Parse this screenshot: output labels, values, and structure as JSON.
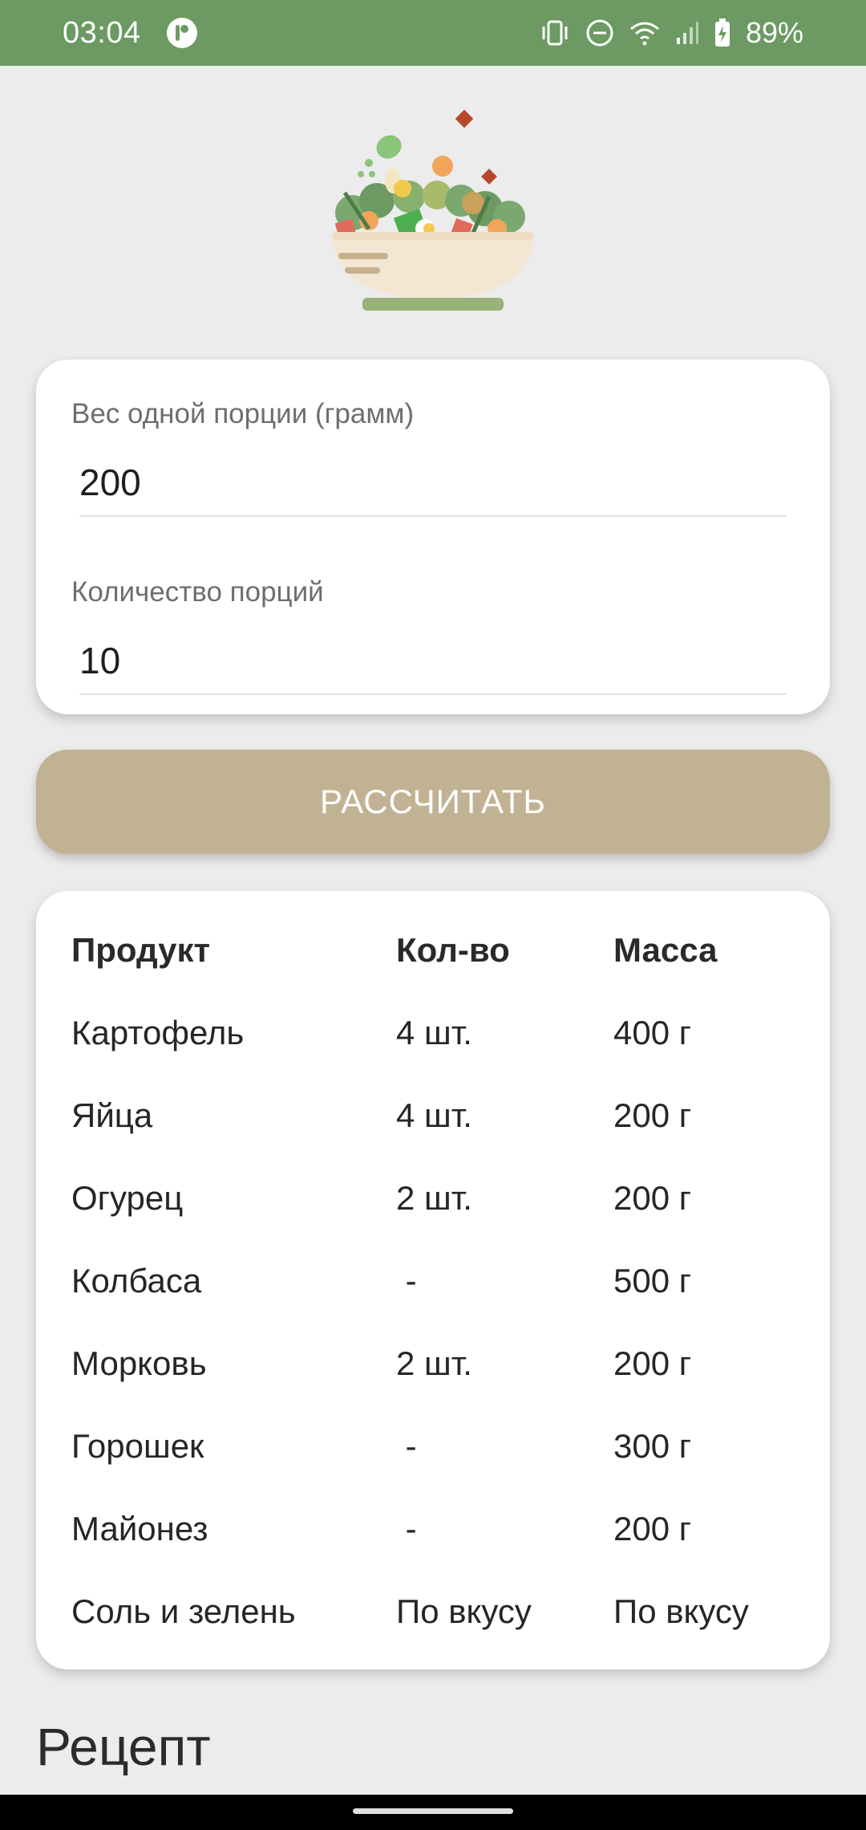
{
  "status_bar": {
    "time": "03:04",
    "battery": "89%",
    "icons": [
      "app-notification-icon",
      "vibrate-icon",
      "do-not-disturb-icon",
      "wifi-icon",
      "signal-icon",
      "battery-charging-icon"
    ]
  },
  "inputs": {
    "portion_weight_label": "Вес одной порции (грамм)",
    "portion_weight_value": "200",
    "portion_count_label": "Количество порций",
    "portion_count_value": "10"
  },
  "calc_button_label": "РАССЧИТАТЬ",
  "table": {
    "headers": [
      "Продукт",
      "Кол-во",
      "Масса"
    ],
    "rows": [
      [
        "Картофель",
        "4 шт.",
        "400 г"
      ],
      [
        "Яйца",
        "4 шт.",
        "200 г"
      ],
      [
        "Огурец",
        "2 шт.",
        "200 г"
      ],
      [
        "Колбаса",
        " -",
        "500 г"
      ],
      [
        "Морковь",
        "2 шт.",
        "200 г"
      ],
      [
        "Горошек",
        " -",
        "300 г"
      ],
      [
        "Майонез",
        " -",
        "200 г"
      ],
      [
        "Соль и зелень",
        "По вкусу",
        "По вкусу"
      ]
    ]
  },
  "recipe_title": "Рецепт",
  "colors": {
    "status_bar": "#6c9a62",
    "background": "#ececec",
    "button": "#c2b294",
    "card": "#ffffff"
  }
}
